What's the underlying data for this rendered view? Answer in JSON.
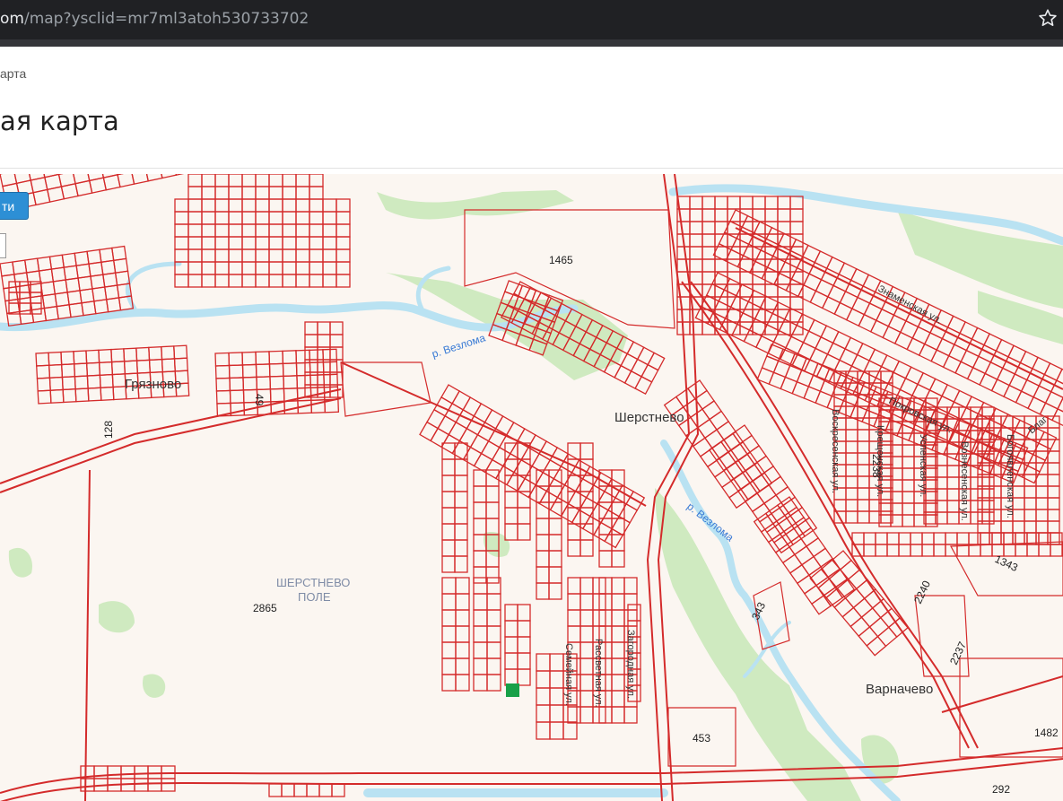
{
  "browser": {
    "url_host": "om",
    "url_path": "/map?ysclid=mr7ml3atoh530733702",
    "star_icon": "star-outline-icon"
  },
  "page": {
    "breadcrumb": "арта",
    "title": "ая карта"
  },
  "map_controls": {
    "search_button": "ти"
  },
  "map_labels": {
    "villages": {
      "gryaznovo": "Грязново",
      "sherstnevo": "Шерстнево",
      "varnachevo": "Варначево"
    },
    "area": [
      "ШЕРСТНЕВО",
      "ПОЛЕ"
    ],
    "rivers": [
      "р. Везлома",
      "р. Везлома"
    ],
    "streets": {
      "znamenskaya": "Знаменская ул.",
      "pokrovskaya": "Покровская ул.",
      "voskresenskaya": "Воскресенская ул.",
      "kreshchenskaya": "Крещенская ул.",
      "uspenskaya": "Успенская ул.",
      "vozneseskaya": "Вознесенская ул.",
      "bogoyavlenskaya": "Богоявленская ул.",
      "blag": "Благ",
      "semeynaya": "Семейная ул.",
      "rassvetnaya": "Рассветная ул.",
      "zagorodnaya": "Загородная ул."
    },
    "parcels": [
      "1465",
      "2865",
      "453",
      "292",
      "1482",
      "1343",
      "2238",
      "2240",
      "2237",
      "343",
      "128",
      "49"
    ]
  },
  "colors": {
    "parcel_line": "#d42b2b",
    "forest": "#cfeac0",
    "river": "#b9e2f2",
    "background": "#fbf6f1",
    "accent_button": "#2d8fd5",
    "marker": "#18a048"
  }
}
